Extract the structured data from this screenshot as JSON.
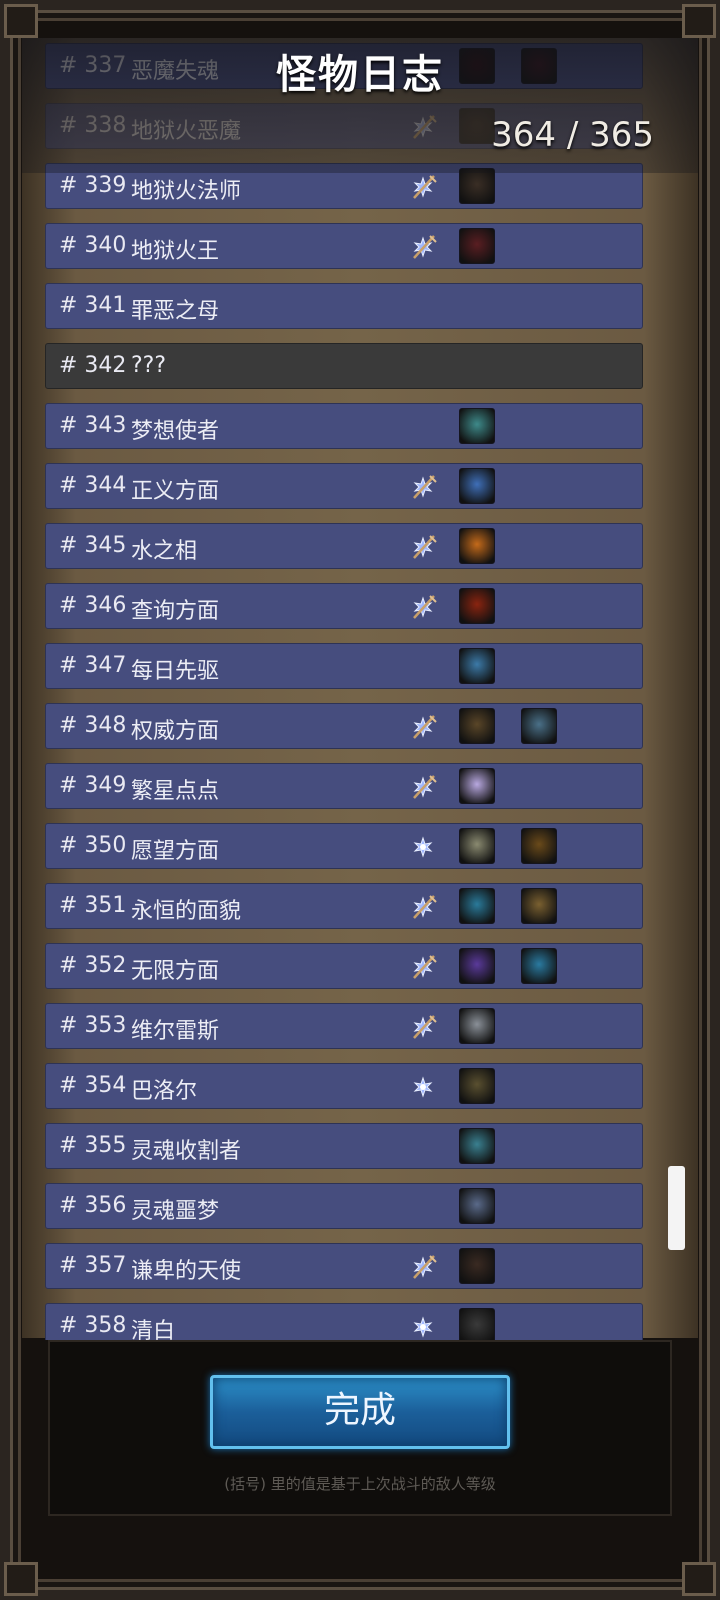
{
  "header": {
    "title": "怪物日志",
    "count": "364 / 365"
  },
  "rows": [
    {
      "num": "# 337",
      "name": "恶魔失魂",
      "badge": "",
      "items": [
        "#2a0a10",
        "#35111a"
      ]
    },
    {
      "num": "# 338",
      "name": "地狱火恶魔",
      "badge": "crossed",
      "items": [
        "#2a1f1a"
      ]
    },
    {
      "num": "# 339",
      "name": "地狱火法师",
      "badge": "crossed",
      "items": [
        "#3a2e25"
      ]
    },
    {
      "num": "# 340",
      "name": "地狱火王",
      "badge": "crossed",
      "items": [
        "#5a1e22"
      ]
    },
    {
      "num": "# 341",
      "name": "罪恶之母",
      "badge": "",
      "items": []
    },
    {
      "num": "# 342",
      "name": "???",
      "badge": "",
      "items": []
    },
    {
      "num": "# 343",
      "name": "梦想使者",
      "badge": "",
      "items": [
        "#3e8a8a"
      ]
    },
    {
      "num": "# 344",
      "name": "正义方面",
      "badge": "crossed",
      "items": [
        "#3f6fb8"
      ]
    },
    {
      "num": "# 345",
      "name": "水之相",
      "badge": "crossed",
      "items": [
        "#c46a1a"
      ]
    },
    {
      "num": "# 346",
      "name": "查询方面",
      "badge": "crossed",
      "items": [
        "#8a2410"
      ]
    },
    {
      "num": "# 347",
      "name": "每日先驱",
      "badge": "",
      "items": [
        "#3c7aa8"
      ]
    },
    {
      "num": "# 348",
      "name": "权威方面",
      "badge": "crossed",
      "items": [
        "#5a4628",
        "#4a7088"
      ]
    },
    {
      "num": "# 349",
      "name": "繁星点点",
      "badge": "crossed",
      "items": [
        "#b8a8e0"
      ]
    },
    {
      "num": "# 350",
      "name": "愿望方面",
      "badge": "gem",
      "items": [
        "#8a8a70",
        "#6a4a1a"
      ]
    },
    {
      "num": "# 351",
      "name": "永恒的面貌",
      "badge": "crossed",
      "items": [
        "#2a7a9a",
        "#7a6030"
      ]
    },
    {
      "num": "# 352",
      "name": "无限方面",
      "badge": "crossed",
      "items": [
        "#5a3a9a",
        "#2a7aa0"
      ]
    },
    {
      "num": "# 353",
      "name": "维尔雷斯",
      "badge": "crossed",
      "items": [
        "#8a9098"
      ]
    },
    {
      "num": "# 354",
      "name": "巴洛尔",
      "badge": "gem",
      "items": [
        "#5a5030"
      ]
    },
    {
      "num": "# 355",
      "name": "灵魂收割者",
      "badge": "",
      "items": [
        "#3a8090"
      ]
    },
    {
      "num": "# 356",
      "name": "灵魂噩梦",
      "badge": "",
      "items": [
        "#5a6a8a"
      ]
    },
    {
      "num": "# 357",
      "name": "谦卑的天使",
      "badge": "crossed",
      "items": [
        "#3a2a22"
      ]
    },
    {
      "num": "# 358",
      "name": "清白",
      "badge": "gem",
      "items": [
        "#3a3a3a"
      ]
    }
  ],
  "done_button": {
    "label": "完成"
  },
  "footnote": "(括号) 里的值是基于上次战斗的敌人等级",
  "colors": {
    "row": "#464d7e",
    "unknown_row": "#3a3a3a",
    "button": "#1b5f9a"
  }
}
